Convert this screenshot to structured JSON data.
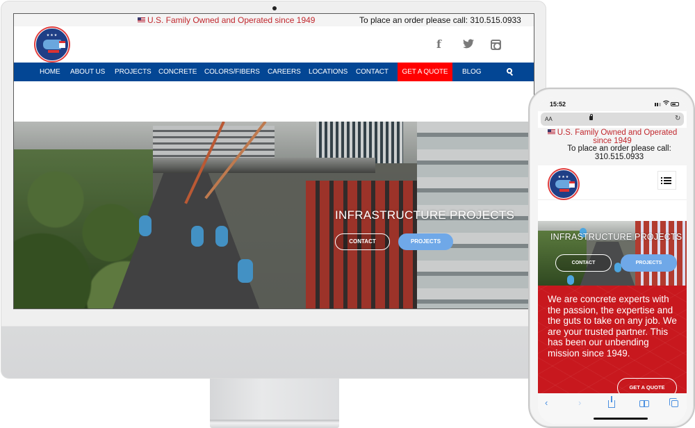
{
  "desktop": {
    "topbar": {
      "family_text": "U.S. Family Owned and Operated since 1949",
      "order_text": "To place an order please call: 310.515.0933",
      "flag_icon": "us-flag-icon"
    },
    "logo_alt": "A&A Ready Mixed Concrete",
    "social": [
      "facebook-icon",
      "twitter-icon",
      "instagram-icon"
    ],
    "nav": {
      "items": [
        {
          "label": "HOME"
        },
        {
          "label": "ABOUT US"
        },
        {
          "label": "PROJECTS"
        },
        {
          "label": "CONCRETE"
        },
        {
          "label": "COLORS/FIBERS"
        },
        {
          "label": "CAREERS"
        },
        {
          "label": "LOCATIONS"
        },
        {
          "label": "CONTACT"
        },
        {
          "label": "GET A QUOTE"
        },
        {
          "label": "BLOG"
        }
      ],
      "search_icon": "search-icon"
    },
    "hero": {
      "title": "INFRASTRUCTURE PROJECTS",
      "contact_label": "CONTACT",
      "projects_label": "PROJECTS"
    }
  },
  "mobile": {
    "status": {
      "time": "15:52"
    },
    "urlbar": {
      "text_size": "AA"
    },
    "topbar": {
      "family_text": "U.S. Family Owned and Operated since 1949",
      "order_text": "To place an order please call: 310.515.0933"
    },
    "hero": {
      "title": "INFRASTRUCTURE PROJECTS",
      "contact_label": "CONTACT",
      "projects_label": "PROJECTS"
    },
    "mission": "We are concrete experts with the passion, the expertise and the guts to take on any job. We are your trusted partner. This has been our unbending mission since 1949.",
    "quote_label": "GET A QUOTE",
    "toolbar": {
      "back": "‹",
      "forward": "›"
    }
  },
  "colors": {
    "nav_blue": "#034694",
    "quote_red": "#ff0000",
    "topbar_red": "#c1272d",
    "mission_red": "#c8181e",
    "projects_blue": "#6fa8e8"
  }
}
